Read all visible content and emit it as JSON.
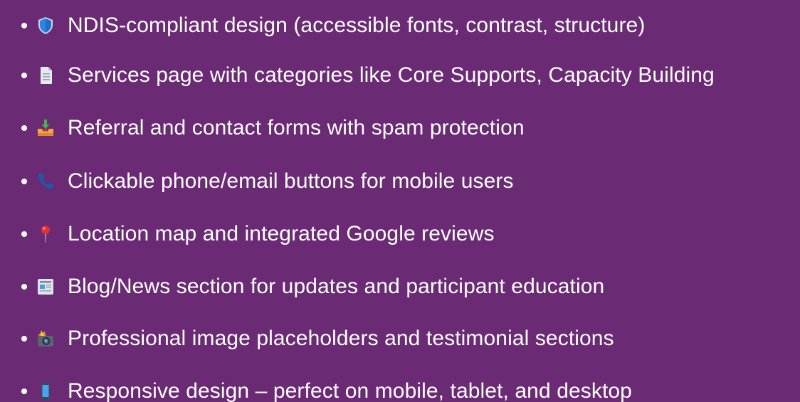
{
  "colors": {
    "background": "#6b2a74",
    "text": "#ffffff"
  },
  "features": [
    {
      "icon": "shield-icon",
      "text": "NDIS-compliant design (accessible fonts, contrast, structure)"
    },
    {
      "icon": "document-icon",
      "text": "Services page with categories like Core Supports, Capacity Building"
    },
    {
      "icon": "inbox-tray-icon",
      "text": "Referral and contact forms with spam protection"
    },
    {
      "icon": "phone-icon",
      "text": "Clickable phone/email buttons for mobile users"
    },
    {
      "icon": "pushpin-icon",
      "text": "Location map and integrated Google reviews"
    },
    {
      "icon": "newspaper-icon",
      "text": "Blog/News section for updates and participant education"
    },
    {
      "icon": "camera-flash-icon",
      "text": "Professional image placeholders and testimonial sections"
    },
    {
      "icon": "mobile-phone-icon",
      "text": "Responsive design – perfect on mobile, tablet, and desktop"
    }
  ]
}
